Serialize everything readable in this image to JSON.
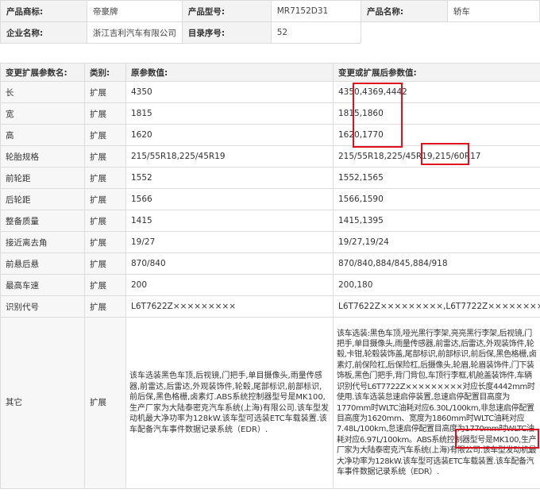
{
  "info": {
    "brand_label": "产品商标:",
    "brand_value": "帝豪牌",
    "model_label": "产品型号:",
    "model_value": "MR7152D31",
    "name_label": "产品名称:",
    "name_value": "轿车",
    "company_label": "企业名称:",
    "company_value": "浙江吉利汽车有限公司",
    "catalog_label": "目录序号:",
    "catalog_value": "52"
  },
  "params": {
    "headers": [
      "变更扩展参数名:",
      "类别:",
      "原参数值:",
      "变更或扩展后参数值:"
    ],
    "rows": [
      {
        "name": "长",
        "cat": "扩展",
        "orig": "4350",
        "new": "4350,4369,4442"
      },
      {
        "name": "宽",
        "cat": "扩展",
        "orig": "1815",
        "new": "1815,1860"
      },
      {
        "name": "高",
        "cat": "扩展",
        "orig": "1620",
        "new": "1620,1770"
      },
      {
        "name": "轮胎规格",
        "cat": "扩展",
        "orig": "215/55R18,225/45R19",
        "new": "215/55R18,225/45R19,215/60R17"
      },
      {
        "name": "前轮距",
        "cat": "扩展",
        "orig": "1552",
        "new": "1552,1565"
      },
      {
        "name": "后轮距",
        "cat": "扩展",
        "orig": "1566",
        "new": "1566,1590"
      },
      {
        "name": "整备质量",
        "cat": "扩展",
        "orig": "1415",
        "new": "1415,1395"
      },
      {
        "name": "接近离去角",
        "cat": "扩展",
        "orig": "19/27",
        "new": "19/27,19/24"
      },
      {
        "name": "前悬后悬",
        "cat": "扩展",
        "orig": "870/840",
        "new": "870/840,884/845,884/918"
      },
      {
        "name": "最高车速",
        "cat": "扩展",
        "orig": "200",
        "new": "200,180"
      },
      {
        "name": "识别代号",
        "cat": "扩展",
        "orig": "L6T7622Z×××××××××",
        "new": "L6T7622Z×××××××××,L6T7722Z×××××××××"
      }
    ],
    "other": {
      "name": "其它",
      "cat": "扩展",
      "orig": "该车选装黑色车顶,后视镜,门把手,单目摄像头,雨量传感器,前雷达,后雷达,外观装饰件,轮毂,尾部标识,前部标识,前后保,黑色格栅,卤素灯.ABS系统控制器型号是MK100,生产厂家为大陆泰密克汽车系统(上海)有限公司.该车型发动机最大净功率为128kW.该车型可选装ETC车载装置.该车配备汽车事件数据记录系统（EDR）.",
      "new": "该车选装:黑色车顶,哑光黑行李架,亮亮黑行李架,后视镜,门把手,单目摄像头,雨量传感器,前雷达,后雷达,外观装饰件,轮毂,卡钳,轮毂装饰盖,尾部标识,前部标识,前后保,黑色格栅,卤素灯,前保险杠,后保险杠,后摄像头,轮眉,轮眉装饰件,门下装饰板,黑色门把手,背门背包,车顶行李框,机舱盖装饰件,车辆识别代号L6T7722Z×××××××××对应长度4442mm时使用.该车选装怠速启停装置,怠速启停配置目高度为1770mm时WLTC油耗对应6.30L/100km,非怠速启停配置目高度为1620mm、宽度为1860mm时WLTC油耗对应7.48L/100km,怠速启停配置目高度为1770mm时WLTC油耗对应6.97L/100km。ABS系统控制器型号是MK100,生产厂家为大陆泰密克汽车系统(上海)有限公司.该车型发动机最大净功率为128kW.该车型可选装ETC车载装置.该车配备汽车事件数据记录系统（EDR）."
    }
  },
  "highlight_color": "#e0101e"
}
